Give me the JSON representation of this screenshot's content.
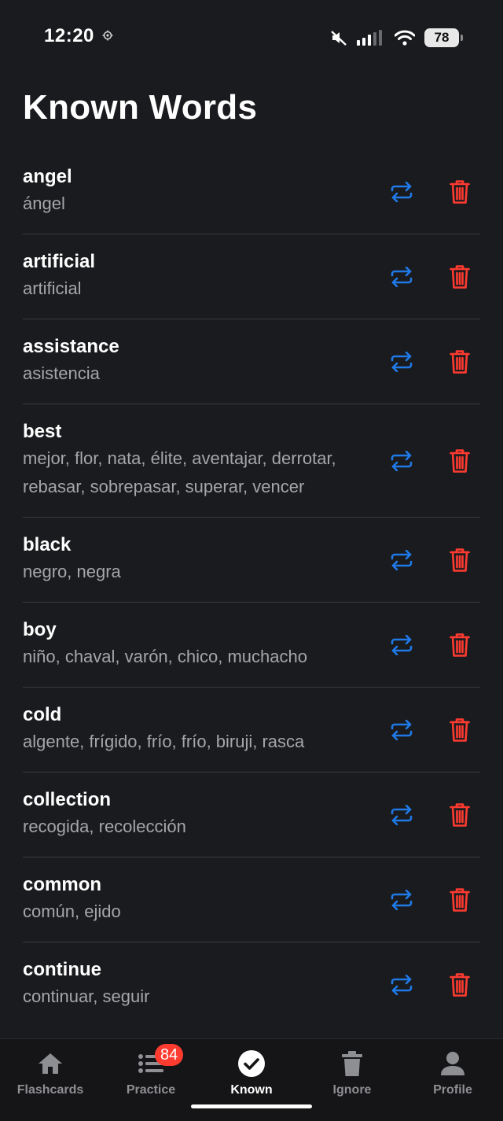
{
  "status_bar": {
    "time": "12:20",
    "battery": "78",
    "icons": [
      "gear-icon",
      "mute-icon",
      "signal-icon",
      "wifi-icon",
      "battery-icon"
    ]
  },
  "page": {
    "title": "Known Words"
  },
  "colors": {
    "background": "#1a1b1e",
    "accent_blue": "#1f7ae8",
    "delete_red": "#ff3b30",
    "muted_text": "#a5a6aa"
  },
  "words": [
    {
      "term": "angel",
      "translation": "ángel"
    },
    {
      "term": "artificial",
      "translation": "artificial"
    },
    {
      "term": "assistance",
      "translation": "asistencia"
    },
    {
      "term": "best",
      "translation": "mejor, flor, nata, élite, aventajar, derrotar, rebasar, sobrepasar, superar, vencer"
    },
    {
      "term": "black",
      "translation": "negro, negra"
    },
    {
      "term": "boy",
      "translation": "niño, chaval, varón, chico, muchacho"
    },
    {
      "term": "cold",
      "translation": "algente, frígido, frío, frío, biruji, rasca"
    },
    {
      "term": "collection",
      "translation": "recogida, recolección"
    },
    {
      "term": "common",
      "translation": "común, ejido"
    },
    {
      "term": "continue",
      "translation": "continuar, seguir"
    }
  ],
  "tabs": [
    {
      "label": "Flashcards",
      "icon": "home-icon"
    },
    {
      "label": "Practice",
      "icon": "list-icon",
      "badge": "84"
    },
    {
      "label": "Known",
      "icon": "check-circle-icon",
      "active": true
    },
    {
      "label": "Ignore",
      "icon": "trash-icon"
    },
    {
      "label": "Profile",
      "icon": "person-icon"
    }
  ]
}
